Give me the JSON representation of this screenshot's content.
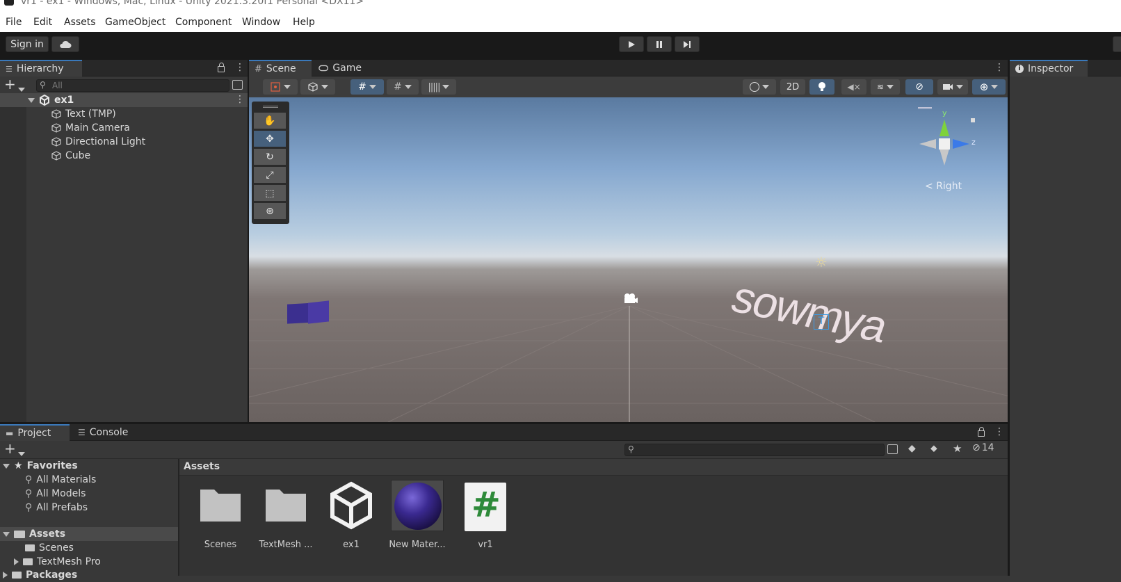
{
  "window": {
    "title": "vr1 - ex1 - Windows, Mac, Linux - Unity 2021.3.20f1 Personal <DX11>"
  },
  "menu": [
    "File",
    "Edit",
    "Assets",
    "GameObject",
    "Component",
    "Window",
    "Help"
  ],
  "toolbar": {
    "sign_in": "Sign in",
    "cloud_icon": "cloud-icon",
    "play_icon": "play-icon",
    "pause_icon": "pause-icon",
    "step_icon": "step-icon"
  },
  "hierarchy": {
    "tab": "Hierarchy",
    "search_placeholder": "All",
    "scene": "ex1",
    "objects": [
      "Text (TMP)",
      "Main Camera",
      "Directional Light",
      "Cube"
    ]
  },
  "scene": {
    "tabs": [
      "Scene",
      "Game"
    ],
    "mode_2d": "2D",
    "gizmo": {
      "y": "y",
      "z": "z",
      "view": "Right"
    },
    "world_text": "sowmya",
    "colors": {
      "accent": "#3a79bb",
      "selected_tool": "#46607c",
      "cube": "#3b2f8f"
    }
  },
  "inspector": {
    "tab": "Inspector"
  },
  "project": {
    "tabs": [
      "Project",
      "Console"
    ],
    "hidden_count": "14",
    "favorites_label": "Favorites",
    "favorites": [
      "All Materials",
      "All Models",
      "All Prefabs"
    ],
    "assets_label": "Assets",
    "asset_folders": [
      "Scenes",
      "TextMesh Pro"
    ],
    "packages_label": "Packages",
    "breadcrumb": "Assets",
    "items": [
      {
        "label": "Scenes",
        "kind": "folder"
      },
      {
        "label": "TextMesh ...",
        "kind": "folder"
      },
      {
        "label": "ex1",
        "kind": "unity-scene"
      },
      {
        "label": "New Mater...",
        "kind": "material"
      },
      {
        "label": "vr1",
        "kind": "script"
      }
    ]
  }
}
